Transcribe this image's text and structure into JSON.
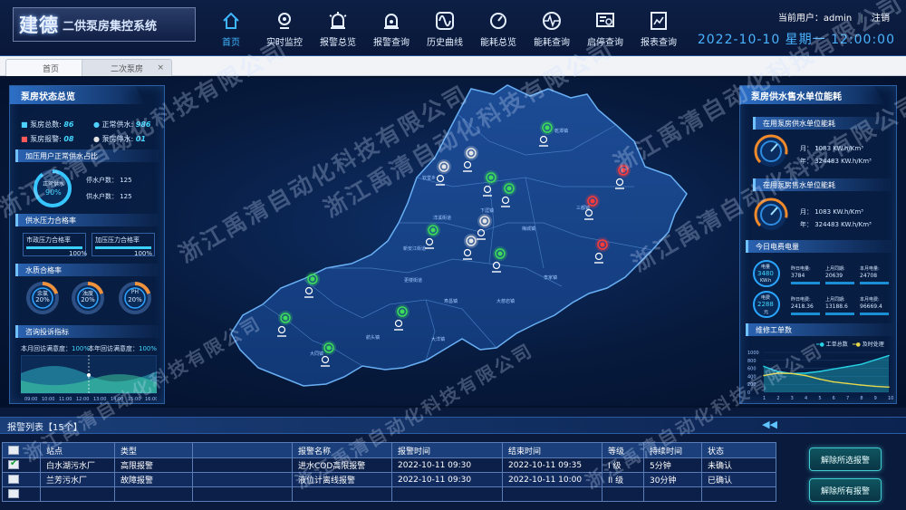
{
  "header": {
    "logo_big": "建德",
    "logo_small": "二供泵房集控系统",
    "nav": [
      "首页",
      "实时监控",
      "报警总览",
      "报警查询",
      "历史曲线",
      "能耗总览",
      "能耗查询",
      "启停查询",
      "报表查询"
    ],
    "nav_icons": [
      "home-icon",
      "camera-icon",
      "alarm-light-icon",
      "alarm-search-icon",
      "curve-icon",
      "gauge-icon",
      "pulse-icon",
      "list-search-icon",
      "report-icon"
    ],
    "user_label": "当前用户：admin",
    "logout": "注销",
    "datetime": "2022-10-10  星期一  12:00:00"
  },
  "tabs": [
    {
      "label": "首页",
      "close": "×"
    },
    {
      "label": "二次泵房",
      "close": "×"
    }
  ],
  "left_panel": {
    "title": "泵房状态总览",
    "stats": [
      {
        "label": "泵房总数:",
        "value": "86"
      },
      {
        "label": "正常供水:",
        "value": "986"
      },
      {
        "label": "泵房报警:",
        "value": "08"
      },
      {
        "label": "泵房停水:",
        "value": "01"
      }
    ],
    "section1": "加压用户正常供水占比",
    "ring_label": "正常供水",
    "ring_value": "90%",
    "ring_fraction": 0.9,
    "stop_users": "停水户数：  125",
    "normal_users": "供水户数：  125",
    "section2": "供水压力合格率",
    "pressure": [
      {
        "label": "市政压力合格率",
        "value": "100%",
        "fraction": 1.0
      },
      {
        "label": "加压压力合格率",
        "value": "100%",
        "fraction": 1.0
      }
    ],
    "section3": "水质合格率",
    "quality": [
      {
        "label": "余氯",
        "value": "20%",
        "fraction": 0.2
      },
      {
        "label": "浊度",
        "value": "20%",
        "fraction": 0.2
      },
      {
        "label": "PH",
        "value": "20%",
        "fraction": 0.2
      }
    ],
    "section4": "咨询投诉指标",
    "visit_month": "本月回访满意度：",
    "visit_month_val": "100%",
    "visit_year": "本年回访满意度：",
    "visit_year_val": "100%",
    "chart_ticks": [
      "09:00",
      "10:00",
      "11:00",
      "12:00",
      "13:00",
      "14:00",
      "15:00",
      "16:00"
    ]
  },
  "map": {
    "station_states": [
      "normal",
      "normal",
      "normal",
      "alarm",
      "offline",
      "offline",
      "offline",
      "normal",
      "normal",
      "alarm",
      "normal",
      "offline",
      "normal",
      "alarm",
      "normal",
      "normal",
      "normal",
      "normal",
      "normal"
    ],
    "labels": [
      "乾潭镇",
      "钦堂乡",
      "下涯镇",
      "洋溪街道",
      "新安江街道",
      "梅城镇",
      "三都镇",
      "更楼街道",
      "寿昌镇",
      "航头镇",
      "大同镇",
      "大洋镇",
      "李家镇",
      "大慈岩镇"
    ]
  },
  "right_panel": {
    "title": "泵房供水售水单位能耗",
    "supply_title": "在用泵房供水单位能耗",
    "supply_month": "月：  1083  KW.h/Km³",
    "supply_year": "年：  324483  KW.h/Km³",
    "sale_title": "在用泵房售水单位能耗",
    "sale_month": "月：  1083  KW.h/Km³",
    "sale_year": "年：  324483  KW.h/Km³",
    "power_title": "今日电费电量",
    "power_label": "电量",
    "power_value": "3480",
    "power_unit": "KW.h",
    "fee_label": "电费",
    "fee_value": "2288",
    "fee_unit": "元",
    "power_cells": [
      {
        "label": "昨日电量:",
        "value": "3784"
      },
      {
        "label": "上月同期:",
        "value": "20639"
      },
      {
        "label": "本月电量:",
        "value": "24708"
      },
      {
        "label": "昨日电费:",
        "value": "2418.36"
      },
      {
        "label": "上月同期:",
        "value": "13188.6"
      },
      {
        "label": "本月电费:",
        "value": "96669.4"
      }
    ],
    "repair_title": "维修工单数",
    "legend": [
      "工单总数",
      "及时处理"
    ],
    "chart_data": {
      "type": "line",
      "x": [
        "1",
        "2",
        "3",
        "4",
        "5",
        "6",
        "7",
        "8",
        "9",
        "10"
      ],
      "yticks": [
        "0",
        "200",
        "400",
        "600",
        "800",
        "1000"
      ],
      "ylim": [
        0,
        1000
      ],
      "series": [
        {
          "name": "工单总数",
          "color": "#27d3e6",
          "values": [
            650,
            520,
            470,
            480,
            520,
            580,
            640,
            700,
            810,
            920
          ]
        },
        {
          "name": "及时处理",
          "color": "#e8d84a",
          "values": [
            420,
            480,
            470,
            420,
            330,
            260,
            220,
            180,
            150,
            130
          ]
        }
      ]
    }
  },
  "alarm_list": {
    "title": "报警列表【15个】",
    "collapse_icon": "◀◀",
    "columns": [
      "站点",
      "类型",
      "",
      "报警名称",
      "报警时间",
      "结束时间",
      "等级",
      "持续时间",
      "状态"
    ],
    "rows": [
      {
        "checked": true,
        "cells": [
          "白水湖污水厂",
          "高限报警",
          "",
          "进水COD高限报警",
          "2022-10-11 09:30",
          "2022-10-11 09:35",
          "I 级",
          "5分钟",
          "未确认"
        ]
      },
      {
        "checked": false,
        "cells": [
          "兰芳污水厂",
          "故障报警",
          "",
          "液位计离线报警",
          "2022-10-11 09:30",
          "2022-10-11 10:00",
          "II 级",
          "30分钟",
          "已确认"
        ]
      },
      {
        "checked": false,
        "cells": [
          "",
          "",
          "",
          "",
          "",
          "",
          "",
          "",
          ""
        ]
      }
    ],
    "btn_clear_selected": "解除所选报警",
    "btn_clear_all": "解除所有报警"
  },
  "watermark": "浙江禹清自动化科技有限公司"
}
